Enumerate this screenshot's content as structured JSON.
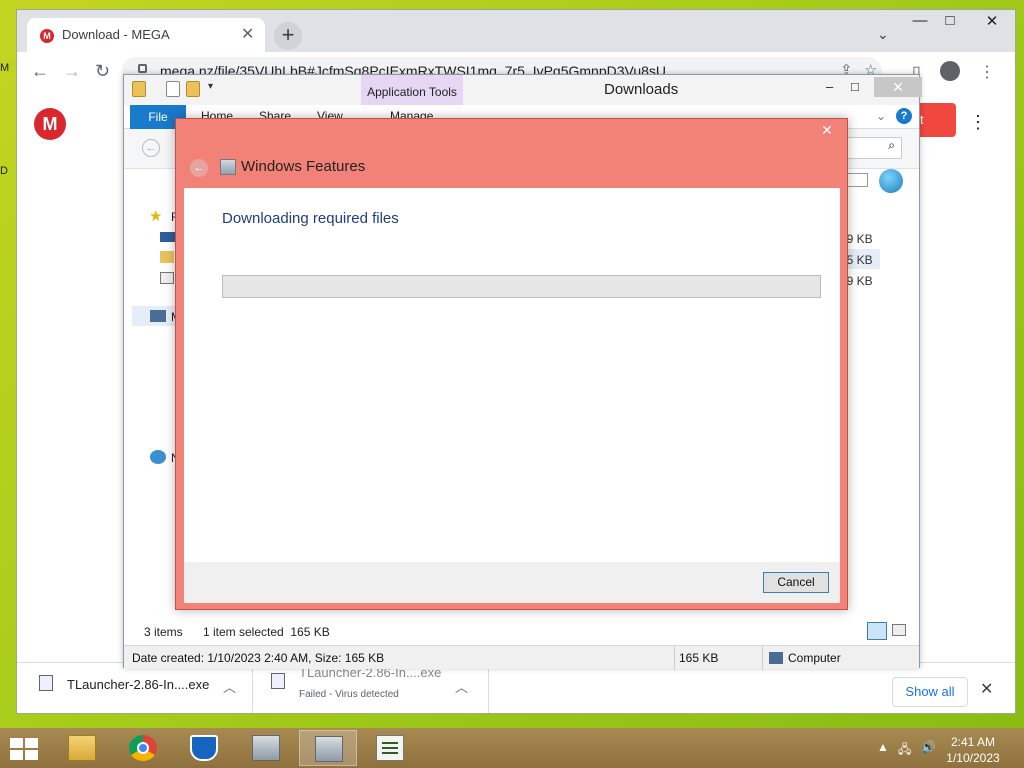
{
  "desktop": {
    "edge_letters": [
      "M",
      "D"
    ]
  },
  "chrome": {
    "tab_title": "Download - MEGA",
    "tab_favicon_letter": "M",
    "url": "mega.nz/file/35VUhLbB#JcfmSq8PcIExmRxTWSI1mq_7r5_IvPq5GmnpD3Vu8sU",
    "window_controls": {
      "minimize": "—",
      "maximize": "□",
      "close": "✕"
    },
    "page": {
      "logo_letter": "M",
      "accent_color": "#d9272e",
      "button_text_fragment": "t"
    },
    "downloads": [
      {
        "name": "TLauncher-2.86-In....exe",
        "status": ""
      },
      {
        "name": "TLauncher-2.86-In....exe",
        "status": "Failed - Virus detected"
      }
    ],
    "show_all_label": "Show all"
  },
  "explorer": {
    "title": "Downloads",
    "context_tab": "Application Tools",
    "ribbon_tabs": [
      "File",
      "Home",
      "Share",
      "View",
      "Manage"
    ],
    "nav_items": [
      "F",
      "M",
      "N"
    ],
    "file_sizes": [
      "39 KB",
      "65 KB",
      "09 KB"
    ],
    "status_items": "3 items",
    "status_selected": "1 item selected  165 KB",
    "details_text": "Date created: 1/10/2023 2:40 AM, Size: 165 KB",
    "details_size": "165 KB",
    "details_location": "Computer"
  },
  "dialog": {
    "title": "Windows Features",
    "heading": "Downloading required files",
    "progress_percent": 0,
    "cancel_label": "Cancel",
    "accent_color": "#f28278"
  },
  "taskbar": {
    "apps": [
      "file-explorer",
      "chrome",
      "windows-defender",
      "setup-package",
      "setup-package",
      "task-list"
    ],
    "active_app_index": 4,
    "clock_time": "2:41 AM",
    "clock_date": "1/10/2023"
  }
}
